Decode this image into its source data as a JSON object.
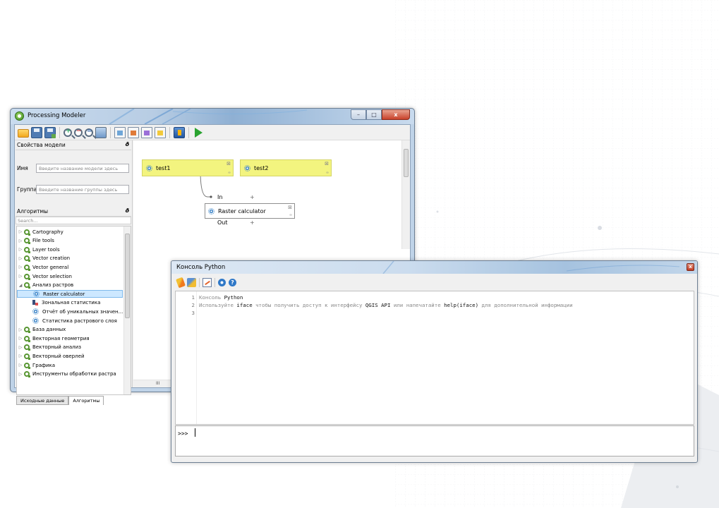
{
  "modeler": {
    "title": "Processing Modeler",
    "caption_min": "–",
    "caption_max": "□",
    "caption_close": "x",
    "properties_panel_title": "Свойства модели",
    "name_label": "Имя",
    "name_placeholder": "Введите название модели здесь",
    "group_label": "Группа",
    "group_placeholder": "Введите название группы здесь",
    "algorithms_panel_title": "Алгоритмы",
    "search_placeholder": "Search...",
    "tree": [
      {
        "label": "Cartography",
        "type": "group",
        "expanded": false
      },
      {
        "label": "File tools",
        "type": "group",
        "expanded": false
      },
      {
        "label": "Layer tools",
        "type": "group",
        "expanded": false
      },
      {
        "label": "Vector creation",
        "type": "group",
        "expanded": false
      },
      {
        "label": "Vector general",
        "type": "group",
        "expanded": false
      },
      {
        "label": "Vector selection",
        "type": "group",
        "expanded": false
      },
      {
        "label": "Анализ растров",
        "type": "group",
        "expanded": true
      },
      {
        "label": "Raster calculator",
        "type": "alg",
        "selected": true
      },
      {
        "label": "Зональная статистика",
        "type": "stat"
      },
      {
        "label": "Отчёт об уникальных значен...",
        "type": "alg"
      },
      {
        "label": "Статистика растрового слоя",
        "type": "alg"
      },
      {
        "label": "База данных",
        "type": "group",
        "expanded": false
      },
      {
        "label": "Векторная геометрия",
        "type": "group",
        "expanded": false
      },
      {
        "label": "Векторный анализ",
        "type": "group",
        "expanded": false
      },
      {
        "label": "Векторный оверлей",
        "type": "group",
        "expanded": false
      },
      {
        "label": "Графика",
        "type": "group",
        "expanded": false
      },
      {
        "label": "Инструменты обработки растра",
        "type": "group",
        "expanded": false
      }
    ],
    "tab_inputs": "Исходные данные",
    "tab_algorithms": "Алгоритмы",
    "canvas": {
      "input1": "test1",
      "input2": "test2",
      "alg": "Raster calculator",
      "port_in": "In",
      "port_out": "Out",
      "port_marker": "+",
      "node_close": "⊠",
      "node_more": "∞",
      "hscroll_grip": "III"
    }
  },
  "console": {
    "title": "Консоль Python",
    "close_glyph": "x",
    "help_glyph": "?",
    "lines": [
      {
        "num": "1",
        "parts": [
          {
            "t": "Консоль ",
            "b": false
          },
          {
            "t": "Python",
            "b": true
          }
        ]
      },
      {
        "num": "2",
        "parts": [
          {
            "t": "Используйте ",
            "b": false
          },
          {
            "t": "iface",
            "b": true
          },
          {
            "t": " чтобы получить доступ к интерфейсу ",
            "b": false
          },
          {
            "t": "QGIS API",
            "b": true
          },
          {
            "t": " или напечатайте ",
            "b": false
          },
          {
            "t": "help(iface)",
            "b": true
          },
          {
            "t": " для дополнительной информации",
            "b": false
          }
        ]
      },
      {
        "num": "3",
        "parts": []
      }
    ],
    "prompt": ">>>"
  }
}
